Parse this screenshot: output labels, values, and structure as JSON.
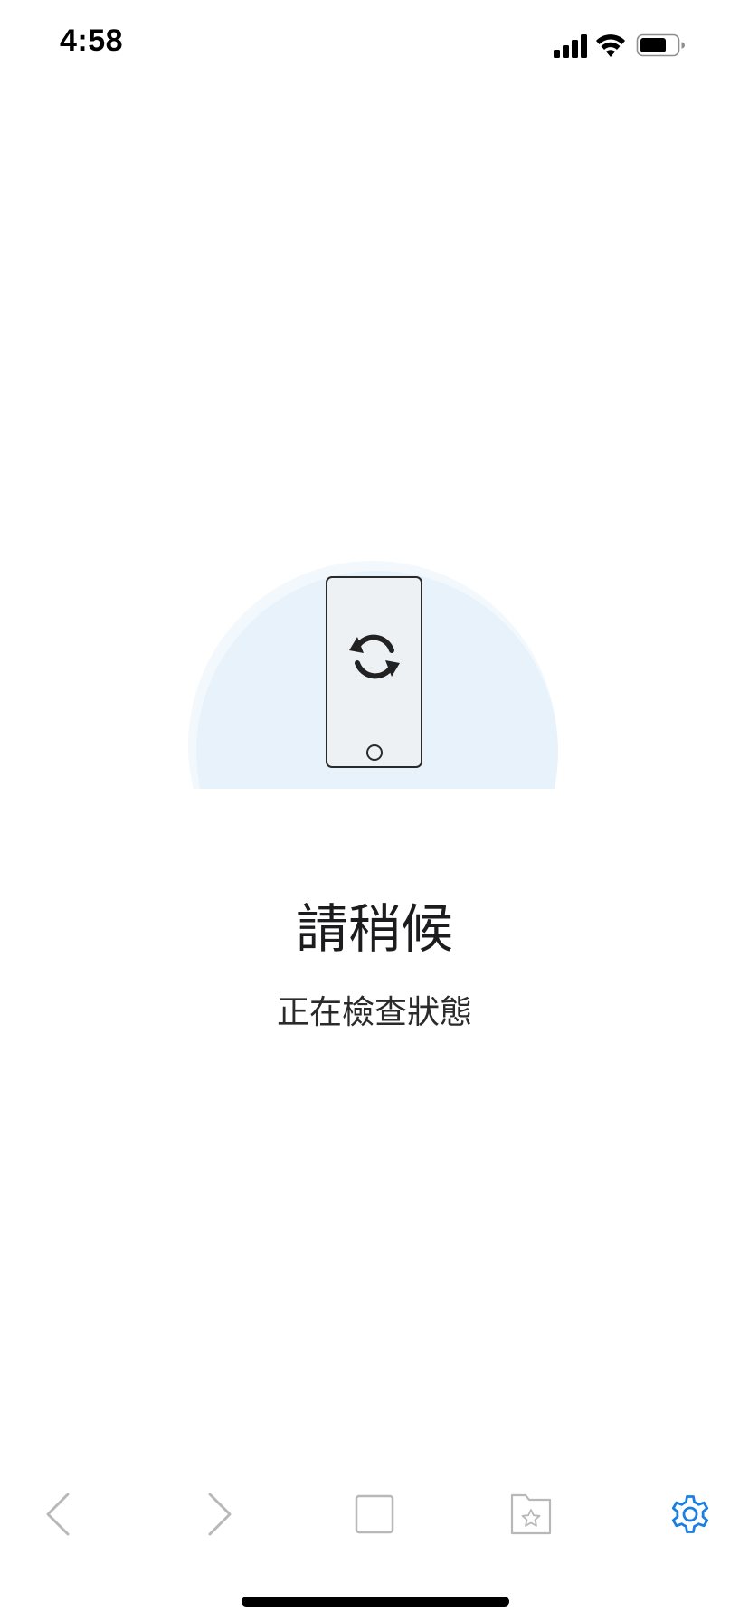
{
  "status_bar": {
    "time": "4:58",
    "icons": [
      "cellular-signal-icon",
      "wifi-icon",
      "battery-icon"
    ]
  },
  "main": {
    "illustration_icon": "phone-refresh-icon",
    "title": "請稍候",
    "subtitle": "正在檢查狀態"
  },
  "toolbar": {
    "items": [
      {
        "icon": "back-arrow-icon",
        "enabled": false
      },
      {
        "icon": "forward-arrow-icon",
        "enabled": false
      },
      {
        "icon": "tabs-square-icon",
        "enabled": false
      },
      {
        "icon": "bookmarks-folder-icon",
        "enabled": false
      },
      {
        "icon": "gear-icon",
        "enabled": true
      }
    ]
  },
  "colors": {
    "accent": "#1a7fe0",
    "disabled_icon": "#b8b8b8",
    "illustration_bg": "#eaf3fc"
  }
}
